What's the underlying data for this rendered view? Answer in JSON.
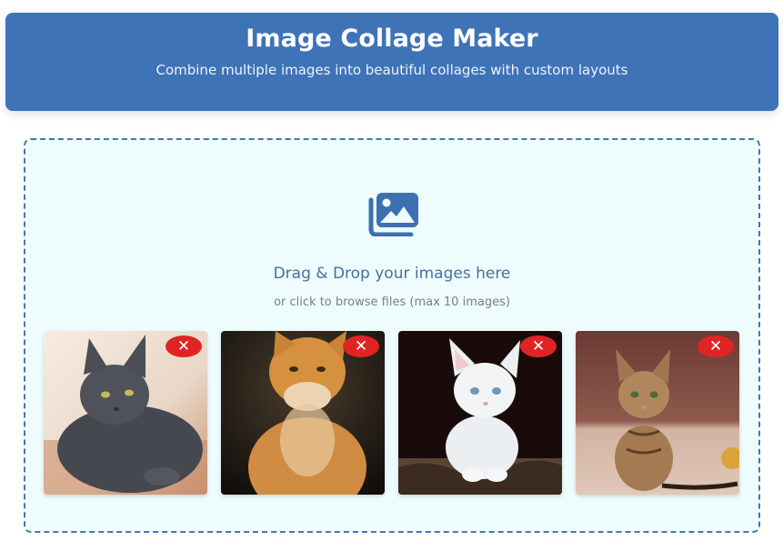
{
  "header": {
    "title": "Image Collage Maker",
    "subtitle": "Combine multiple images into beautiful collages with custom layouts"
  },
  "dropzone": {
    "icon": "images-icon",
    "title": "Drag & Drop your images here",
    "subtitle": "or click to browse files (max 10 images)"
  },
  "images": [
    {
      "subject": "gray cat lying down",
      "remove_label": "✕"
    },
    {
      "subject": "orange tabby cat sitting",
      "remove_label": "✕"
    },
    {
      "subject": "white kitten",
      "remove_label": "✕"
    },
    {
      "subject": "tabby kitten sitting",
      "remove_label": "✕"
    }
  ],
  "colors": {
    "header_bg": "#3e73b8",
    "dropzone_bg": "#eefcfd",
    "dropzone_border": "#4a76ac",
    "remove_button": "#e02424"
  }
}
